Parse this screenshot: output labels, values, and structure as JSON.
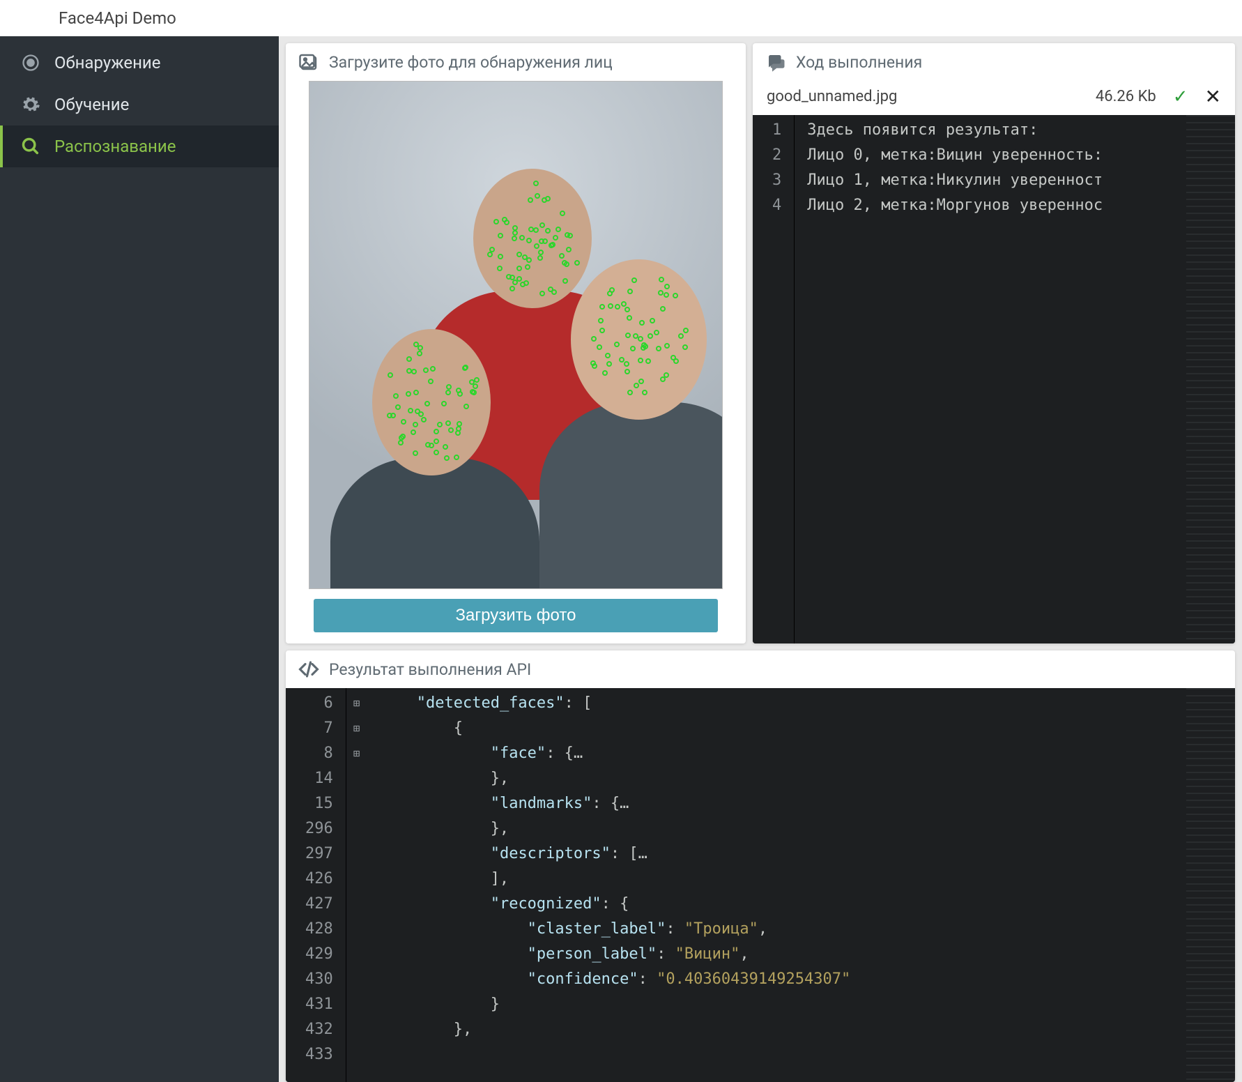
{
  "app_title": "Face4Api Demo",
  "sidebar": {
    "items": [
      {
        "label": "Обнаружение",
        "icon": "target-icon",
        "active": false
      },
      {
        "label": "Обучение",
        "icon": "gears-icon",
        "active": false
      },
      {
        "label": "Распознавание",
        "icon": "search-icon",
        "active": true
      }
    ]
  },
  "upload_panel": {
    "title": "Загрузите фото для обнаружения лиц",
    "button_label": "Загрузить фото"
  },
  "log_panel": {
    "title": "Ход выполнения",
    "file": {
      "name": "good_unnamed.jpg",
      "size": "46.26 Kb"
    },
    "lines": [
      {
        "n": "1",
        "text": "Здесь появится результат:"
      },
      {
        "n": "2",
        "text": "Лицо 0, метка:Вицин уверенность:"
      },
      {
        "n": "3",
        "text": "Лицо 1, метка:Никулин уверенност"
      },
      {
        "n": "4",
        "text": "Лицо 2, метка:Моргунов увереннос"
      }
    ]
  },
  "result_panel": {
    "title": "Результат выполнения API",
    "lines": [
      {
        "n": "6",
        "fold": "",
        "html": "    <span class='tok-key'>\"detected_faces\"</span>: ["
      },
      {
        "n": "7",
        "fold": "",
        "html": "        {"
      },
      {
        "n": "8",
        "fold": "+",
        "html": "            <span class='tok-key'>\"face\"</span>: {<span class='tok-punc'>…</span>"
      },
      {
        "n": "14",
        "fold": "",
        "html": "            },"
      },
      {
        "n": "15",
        "fold": "+",
        "html": "            <span class='tok-key'>\"landmarks\"</span>: {<span class='tok-punc'>…</span>"
      },
      {
        "n": "296",
        "fold": "",
        "html": "            },"
      },
      {
        "n": "297",
        "fold": "+",
        "html": "            <span class='tok-key'>\"descriptors\"</span>: [<span class='tok-punc'>…</span>"
      },
      {
        "n": "426",
        "fold": "",
        "html": "            ],"
      },
      {
        "n": "427",
        "fold": "",
        "html": "            <span class='tok-key'>\"recognized\"</span>: {"
      },
      {
        "n": "428",
        "fold": "",
        "html": "                <span class='tok-key'>\"claster_label\"</span>: <span class='tok-str'>\"Троица\"</span>,"
      },
      {
        "n": "429",
        "fold": "",
        "html": "                <span class='tok-key'>\"person_label\"</span>: <span class='tok-str'>\"Вицин\"</span>,"
      },
      {
        "n": "430",
        "fold": "",
        "html": "                <span class='tok-key'>\"confidence\"</span>: <span class='tok-num'>\"0.40360439149254307\"</span>"
      },
      {
        "n": "431",
        "fold": "",
        "html": "            }"
      },
      {
        "n": "432",
        "fold": "",
        "html": "        },"
      },
      {
        "n": "433",
        "fold": "",
        "html": ""
      }
    ]
  }
}
